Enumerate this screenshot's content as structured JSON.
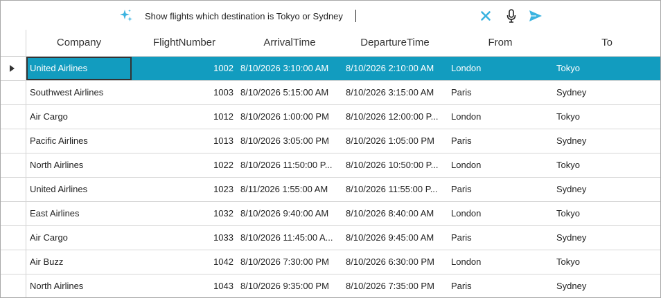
{
  "prompt": {
    "value": "Show flights which destination is Tokyo or Sydney",
    "icons": {
      "sparkle": "sparkle-icon",
      "clear": "close-icon",
      "mic": "microphone-icon",
      "send": "send-icon"
    },
    "accent_color": "#3ab3e0"
  },
  "grid": {
    "columns": [
      "Company",
      "FlightNumber",
      "ArrivalTime",
      "DepartureTime",
      "From",
      "To"
    ],
    "selected_color": "#129cbf",
    "rows": [
      {
        "company": "United Airlines",
        "flight": "1002",
        "arrival": "8/10/2026 3:10:00 AM",
        "departure": "8/10/2026 2:10:00 AM",
        "from": "London",
        "to": "Tokyo"
      },
      {
        "company": "Southwest Airlines",
        "flight": "1003",
        "arrival": "8/10/2026 5:15:00 AM",
        "departure": "8/10/2026 3:15:00 AM",
        "from": "Paris",
        "to": "Sydney"
      },
      {
        "company": "Air Cargo",
        "flight": "1012",
        "arrival": "8/10/2026 1:00:00 PM",
        "departure": "8/10/2026 12:00:00 P...",
        "from": "London",
        "to": "Tokyo"
      },
      {
        "company": "Pacific Airlines",
        "flight": "1013",
        "arrival": "8/10/2026 3:05:00 PM",
        "departure": "8/10/2026 1:05:00 PM",
        "from": "Paris",
        "to": "Sydney"
      },
      {
        "company": "North Airlines",
        "flight": "1022",
        "arrival": "8/10/2026 11:50:00 P...",
        "departure": "8/10/2026 10:50:00 P...",
        "from": "London",
        "to": "Tokyo"
      },
      {
        "company": "United Airlines",
        "flight": "1023",
        "arrival": "8/11/2026 1:55:00 AM",
        "departure": "8/10/2026 11:55:00 P...",
        "from": "Paris",
        "to": "Sydney"
      },
      {
        "company": "East Airlines",
        "flight": "1032",
        "arrival": "8/10/2026 9:40:00 AM",
        "departure": "8/10/2026 8:40:00 AM",
        "from": "London",
        "to": "Tokyo"
      },
      {
        "company": "Air Cargo",
        "flight": "1033",
        "arrival": "8/10/2026 11:45:00 A...",
        "departure": "8/10/2026 9:45:00 AM",
        "from": "Paris",
        "to": "Sydney"
      },
      {
        "company": "Air Buzz",
        "flight": "1042",
        "arrival": "8/10/2026 7:30:00 PM",
        "departure": "8/10/2026 6:30:00 PM",
        "from": "London",
        "to": "Tokyo"
      },
      {
        "company": "North Airlines",
        "flight": "1043",
        "arrival": "8/10/2026 9:35:00 PM",
        "departure": "8/10/2026 7:35:00 PM",
        "from": "Paris",
        "to": "Sydney"
      }
    ]
  }
}
